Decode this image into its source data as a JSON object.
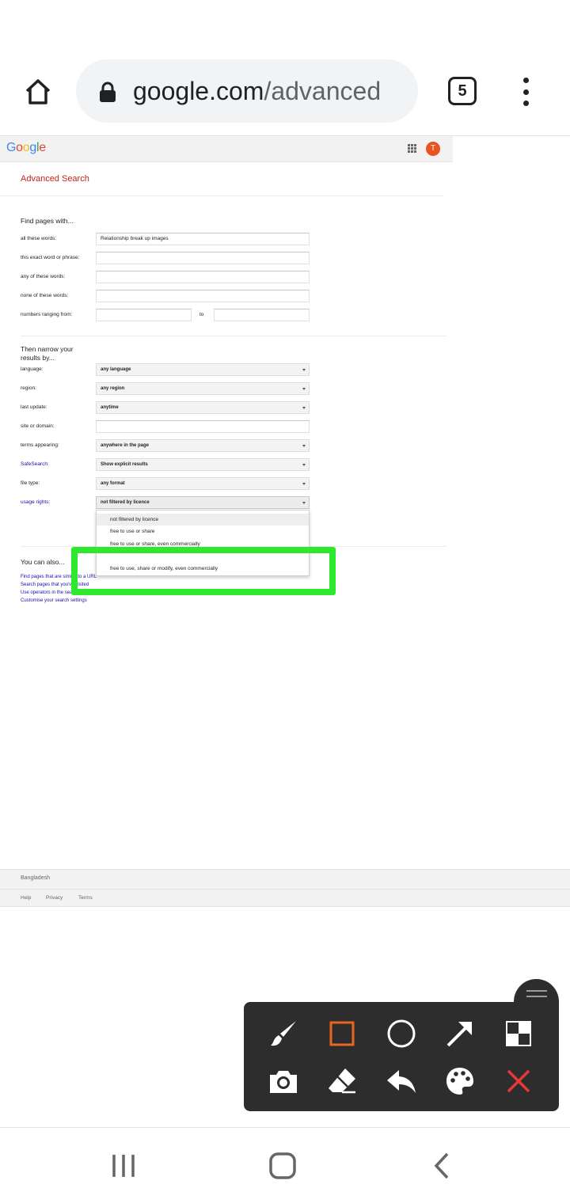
{
  "browser": {
    "url_host": "google.com",
    "url_path": "/advanced",
    "tab_count": "5"
  },
  "google_bar": {
    "logo_letters": [
      "G",
      "o",
      "o",
      "g",
      "l",
      "e"
    ],
    "logo_colors": [
      "#4285f4",
      "#ea4335",
      "#fbbc05",
      "#4285f4",
      "#34a853",
      "#ea4335"
    ],
    "avatar_letter": "T"
  },
  "page": {
    "title": "Advanced Search",
    "find_section": {
      "heading": "Find pages with...",
      "rows": [
        {
          "label": "all these words:",
          "value": "Relationship break up images"
        },
        {
          "label": "this exact word or phrase:",
          "value": ""
        },
        {
          "label": "any of these words:",
          "value": ""
        },
        {
          "label": "none of these words:",
          "value": ""
        }
      ],
      "numbers_label": "numbers ranging from:",
      "numbers_to": "to"
    },
    "narrow_section": {
      "heading_line1": "Then narrow your",
      "heading_line2": "results by...",
      "language": {
        "label": "language:",
        "value": "any language"
      },
      "region": {
        "label": "region:",
        "value": "any region"
      },
      "last_update": {
        "label": "last update:",
        "value": "anytime"
      },
      "site": {
        "label": "site or domain:",
        "value": ""
      },
      "terms": {
        "label": "terms appearing:",
        "value": "anywhere in the page"
      },
      "safesearch": {
        "label": "SafeSearch:",
        "value": "Show explicit results"
      },
      "file_type": {
        "label": "file type:",
        "value": "any format"
      },
      "usage_rights": {
        "label": "usage rights:",
        "value": "not filtered by licence"
      }
    },
    "usage_dropdown": {
      "options": [
        "not filtered by licence",
        "free to use or share",
        "free to use or share, even commercially",
        "free to use, share or modify, even commercially"
      ],
      "selected_index": 0
    },
    "also_section": {
      "heading": "You can also...",
      "links": [
        "Find pages that are similar to a URL",
        "Search pages that you've visited",
        "Use operators in the search box",
        "Customise your search settings"
      ]
    },
    "footer": {
      "country": "Bangladesh",
      "links": [
        "Help",
        "Privacy",
        "Terms"
      ]
    }
  },
  "annotation_toolbar": {
    "tools": [
      "brush-icon",
      "rectangle-icon",
      "circle-icon",
      "arrow-icon",
      "mosaic-icon",
      "camera-icon",
      "eraser-icon",
      "undo-icon",
      "palette-icon",
      "close-icon"
    ],
    "active_color": "#e8661f",
    "close_color": "#e53935",
    "highlight_color": "#2ee82e"
  },
  "system_nav": [
    "recents-button",
    "home-button",
    "back-button"
  ]
}
